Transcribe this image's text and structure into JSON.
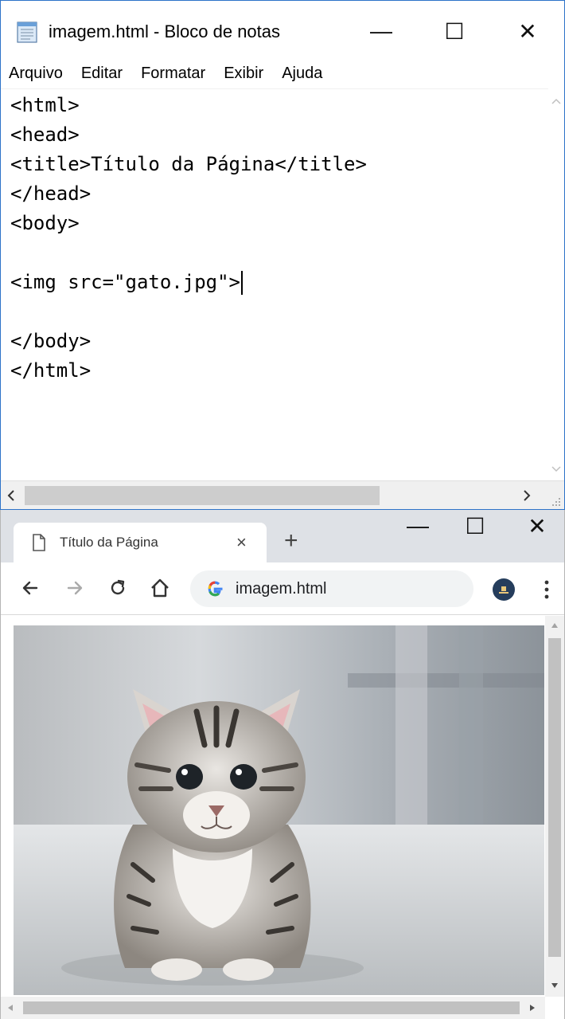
{
  "notepad": {
    "title": "imagem.html - Bloco de notas",
    "buttons": {
      "minimize": "—",
      "maximize": "☐",
      "close": "✕"
    },
    "menu": [
      "Arquivo",
      "Editar",
      "Formatar",
      "Exibir",
      "Ajuda"
    ],
    "lines": [
      "<html>",
      "<head>",
      "<title>Título da Página</title>",
      "</head>",
      "<body>",
      "",
      "<img src=\"gato.jpg\">",
      "",
      "</body>",
      "</html>"
    ]
  },
  "browser": {
    "tab_title": "Título da Página",
    "tab_close": "×",
    "new_tab": "+",
    "buttons": {
      "minimize": "—",
      "maximize": "☐",
      "close": "✕"
    },
    "url": "imagem.html",
    "icons": {
      "back": "back-arrow-icon",
      "forward": "forward-arrow-icon",
      "reload": "reload-icon",
      "home": "home-icon",
      "google": "google-g-icon",
      "profile": "profile-avatar-icon",
      "menu": "kebab-menu-icon",
      "document": "document-icon"
    },
    "content": {
      "image": "cat-kitten-photo"
    }
  },
  "colors": {
    "notepad_border": "#2d73c8",
    "chrome_tabstrip": "#dee1e6",
    "omnibox": "#f1f3f4",
    "avatar": "#253d5c"
  }
}
